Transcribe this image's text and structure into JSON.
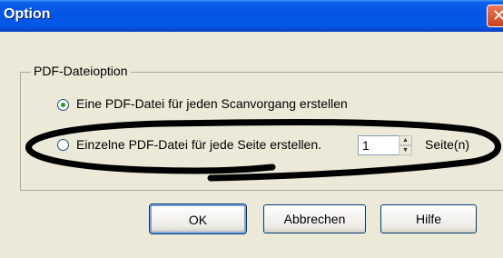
{
  "window": {
    "title": "Option",
    "close_glyph": "✕"
  },
  "group": {
    "label": "PDF-Dateioption",
    "options": [
      {
        "label": "Eine PDF-Datei für jeden Scanvorgang erstellen",
        "checked": true
      },
      {
        "label": "Einzelne PDF-Datei für jede Seite erstellen.",
        "checked": false
      }
    ],
    "pages_value": "1",
    "pages_suffix": "Seite(n)"
  },
  "buttons": {
    "ok": "OK",
    "cancel": "Abbrechen",
    "help": "Hilfe"
  },
  "annotation": {
    "color": "#000000"
  }
}
